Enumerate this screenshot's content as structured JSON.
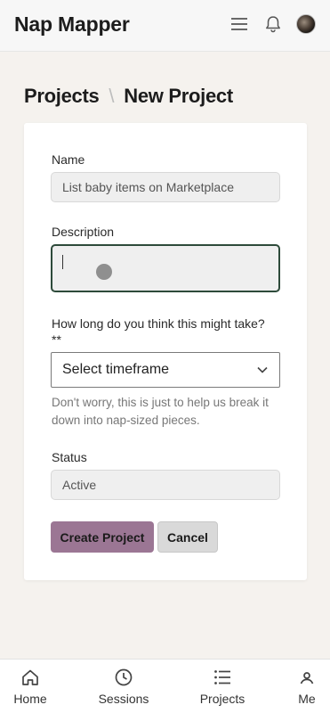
{
  "app": {
    "title": "Nap Mapper"
  },
  "header": {
    "icons": [
      "menu-icon",
      "bell-icon",
      "avatar"
    ]
  },
  "breadcrumb": {
    "parent": "Projects",
    "separator": "\\",
    "current": "New Project"
  },
  "form": {
    "name": {
      "label": "Name",
      "value": "List baby items on Marketplace"
    },
    "description": {
      "label": "Description",
      "value": ""
    },
    "timeframe": {
      "label": "How long do you think this might take?",
      "required_marker": "**",
      "selected": "Select timeframe",
      "helper": "Don't worry, this is just to help us break it down into nap-sized pieces."
    },
    "status": {
      "label": "Status",
      "value": "Active"
    },
    "buttons": {
      "create": "Create Project",
      "cancel": "Cancel"
    }
  },
  "bottom_nav": {
    "items": [
      {
        "label": "Home",
        "icon": "home-icon"
      },
      {
        "label": "Sessions",
        "icon": "clock-icon"
      },
      {
        "label": "Projects",
        "icon": "list-icon"
      },
      {
        "label": "Me",
        "icon": "person-icon"
      }
    ]
  },
  "colors": {
    "primary_button": "#9b7694",
    "focus_border": "#2d4a3a",
    "page_background": "#f5f2ee"
  }
}
